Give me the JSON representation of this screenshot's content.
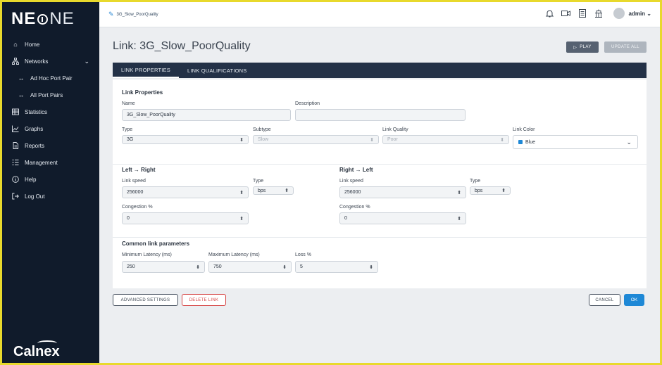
{
  "app": {
    "logo_a": "NE",
    "logo_b": "NE",
    "brand_footer": "Calnex",
    "accent": "#1e88d6",
    "sidebar_bg": "#101b2b"
  },
  "sidebar": {
    "items": [
      {
        "label": "Home",
        "icon": "home-icon"
      },
      {
        "label": "Networks",
        "icon": "network-icon",
        "expanded": true
      },
      {
        "label": "Ad Hoc Port Pair",
        "icon": "swap-arrows-icon"
      },
      {
        "label": "All Port Pairs",
        "icon": "swap-arrows-icon"
      },
      {
        "label": "Statistics",
        "icon": "table-icon"
      },
      {
        "label": "Graphs",
        "icon": "chart-icon"
      },
      {
        "label": "Reports",
        "icon": "document-icon"
      },
      {
        "label": "Management",
        "icon": "list-icon"
      },
      {
        "label": "Help",
        "icon": "info-icon"
      },
      {
        "label": "Log Out",
        "icon": "logout-icon"
      }
    ]
  },
  "topbar": {
    "breadcrumb": "3G_Slow_PoorQuality",
    "user": "admin"
  },
  "header": {
    "title": "Link: 3G_Slow_PoorQuality",
    "play_label": "PLAY",
    "update_all_label": "UPDATE ALL"
  },
  "tabs": [
    {
      "label": "LINK PROPERTIES",
      "active": true
    },
    {
      "label": "LINK QUALIFICATIONS",
      "active": false
    }
  ],
  "link_properties": {
    "section_title": "Link Properties",
    "name_label": "Name",
    "name_value": "3G_Slow_PoorQuality",
    "description_label": "Description",
    "description_value": "",
    "type_label": "Type",
    "type_value": "3G",
    "subtype_label": "Subtype",
    "subtype_value": "Slow",
    "quality_label": "Link Quality",
    "quality_value": "Poor",
    "color_label": "Link Color",
    "color_value": "Blue",
    "color_hex": "#1e88d6"
  },
  "left_right": {
    "title": "Left → Right",
    "speed_label": "Link speed",
    "speed_value": "256000",
    "type_label": "Type",
    "type_value": "bps",
    "congestion_label": "Congestion %",
    "congestion_value": "0"
  },
  "right_left": {
    "title": "Right → Left",
    "speed_label": "Link speed",
    "speed_value": "256000",
    "type_label": "Type",
    "type_value": "bps",
    "congestion_label": "Congestion %",
    "congestion_value": "0"
  },
  "common": {
    "title": "Common link parameters",
    "min_latency_label": "Minimum Latency (ms)",
    "min_latency_value": "250",
    "max_latency_label": "Maximum Latency (ms)",
    "max_latency_value": "750",
    "loss_label": "Loss %",
    "loss_value": "5"
  },
  "footer": {
    "advanced_label": "ADVANCED SETTINGS",
    "delete_label": "DELETE LINK",
    "cancel_label": "CANCEL",
    "ok_label": "OK"
  }
}
